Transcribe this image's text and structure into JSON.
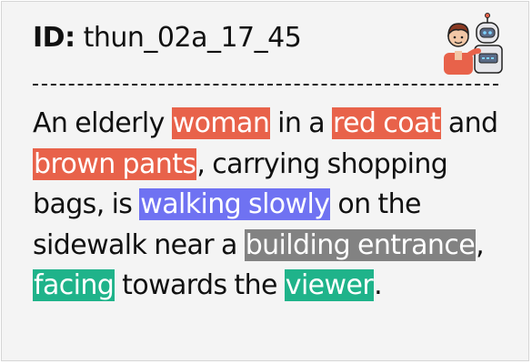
{
  "header": {
    "id_label": "ID:",
    "id_value": "thun_02a_17_45",
    "icon": "person-and-robot-icon"
  },
  "caption": {
    "segments": [
      {
        "text": "An elderly ",
        "highlight": null
      },
      {
        "text": "woman",
        "highlight": "#e8624a"
      },
      {
        "text": " in a ",
        "highlight": null
      },
      {
        "text": "red coat",
        "highlight": "#e8624a"
      },
      {
        "text": " and ",
        "highlight": null
      },
      {
        "text": "brown pants",
        "highlight": "#e8624a"
      },
      {
        "text": ", carrying shopping bags, is ",
        "highlight": null
      },
      {
        "text": "walking slowly",
        "highlight": "#6f72f2"
      },
      {
        "text": " on the sidewalk near a ",
        "highlight": null
      },
      {
        "text": "building entrance",
        "highlight": "#828282"
      },
      {
        "text": ", ",
        "highlight": null
      },
      {
        "text": "facing",
        "highlight": "#1fb38a"
      },
      {
        "text": " towards the ",
        "highlight": null
      },
      {
        "text": "viewer",
        "highlight": "#1fb38a"
      },
      {
        "text": ".",
        "highlight": null
      }
    ]
  }
}
